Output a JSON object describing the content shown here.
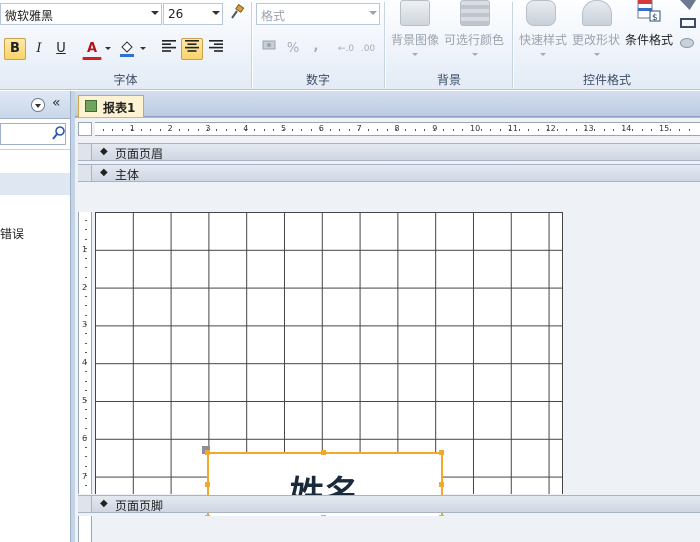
{
  "ribbon": {
    "font_group": {
      "font_name": "微软雅黑",
      "font_size": "26",
      "bold_label": "B",
      "italic_label": "I",
      "underline_label": "U",
      "font_color_label": "A",
      "label": "字体"
    },
    "number_group": {
      "format_placeholder": "格式",
      "percent_label": "%",
      "comma_label": ",",
      "inc_decimal_label": "←.0",
      "dec_decimal_label": ".00",
      "label": "数字"
    },
    "background_group": {
      "bg_image_label": "背景图像",
      "alt_row_color_label": "可选行颜色",
      "label": "背景"
    },
    "control_format_group": {
      "quick_styles_label": "快速样式",
      "change_shape_label": "更改形状",
      "conditional_format_label": "条件格式",
      "label": "控件格式"
    }
  },
  "nav": {
    "partial_text": "错误"
  },
  "tabs": [
    {
      "label": "报表1",
      "active": true
    }
  ],
  "ruler": {
    "h_numbers": [
      "1",
      "2",
      "3",
      "4",
      "5",
      "6",
      "7",
      "8",
      "9",
      "10",
      "11",
      "12",
      "13",
      "14",
      "15"
    ],
    "v_numbers": [
      "1",
      "2",
      "3",
      "4",
      "5",
      "6",
      "7"
    ]
  },
  "sections": {
    "page_header": "页面页眉",
    "detail": "主体",
    "page_footer": "页面页脚"
  },
  "label_control": {
    "text": "姓名"
  },
  "colors": {
    "accent_selection": "#f0a92c",
    "tab_active_bg": "#fdf3d3"
  }
}
